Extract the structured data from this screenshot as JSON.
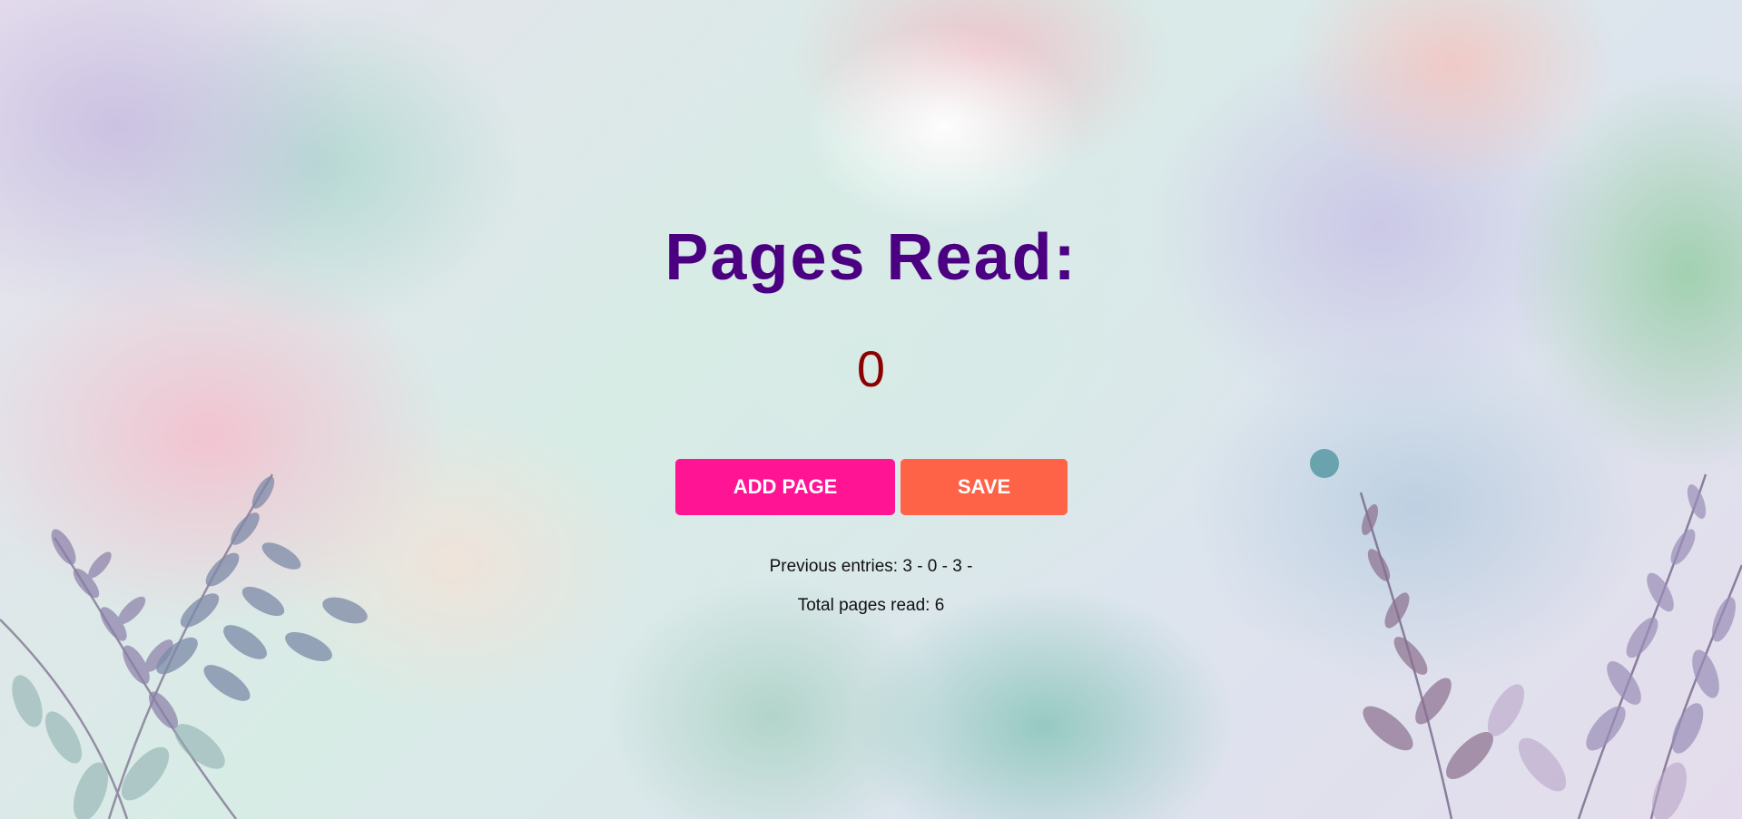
{
  "header": {
    "title": "Pages Read:"
  },
  "counter": {
    "value": "0"
  },
  "actions": {
    "add_label": "ADD PAGE",
    "save_label": "SAVE"
  },
  "history": {
    "previous_entries": "Previous entries: 3 - 0 - 3 -",
    "total_pages": "Total pages read: 6"
  },
  "colors": {
    "title": "#4b0082",
    "counter": "#8b0000",
    "add_button": "#ff1493",
    "save_button": "#ff6347"
  }
}
